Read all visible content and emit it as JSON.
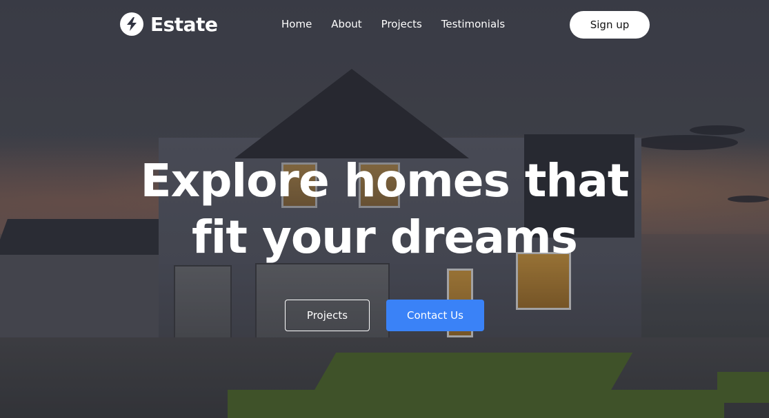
{
  "brand": {
    "name": "Estate",
    "icon": "lightning-bolt-icon",
    "icon_bg": "#ffffff"
  },
  "nav": {
    "items": [
      {
        "label": "Home"
      },
      {
        "label": "About"
      },
      {
        "label": "Projects"
      },
      {
        "label": "Testimonials"
      }
    ],
    "signup_label": "Sign up"
  },
  "hero": {
    "headline_line1": "Explore homes that",
    "headline_line2": "fit your dreams",
    "buttons": {
      "projects_label": "Projects",
      "contact_label": "Contact Us"
    }
  },
  "colors": {
    "accent": "#3a82f7",
    "text": "#ffffff"
  }
}
